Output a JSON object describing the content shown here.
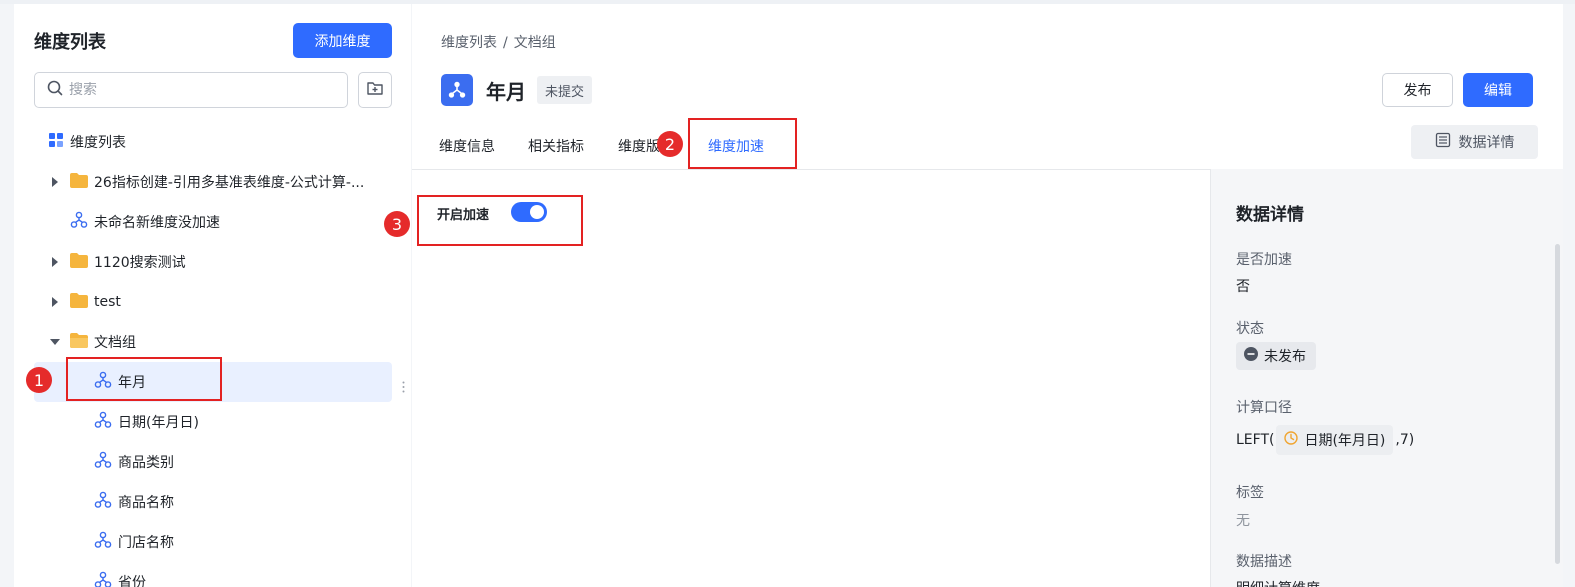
{
  "sidebar": {
    "title": "维度列表",
    "add_button": "添加维度",
    "search_placeholder": "搜索",
    "items": [
      {
        "label": "维度列表",
        "type": "root"
      },
      {
        "label": "26指标创建-引用多基准表维度-公式计算-...",
        "type": "folder",
        "state": "collapsed"
      },
      {
        "label": "未命名新维度没加速",
        "type": "dimension"
      },
      {
        "label": "1120搜索测试",
        "type": "folder",
        "state": "collapsed"
      },
      {
        "label": "test",
        "type": "folder",
        "state": "collapsed"
      },
      {
        "label": "文档组",
        "type": "folder",
        "state": "expanded"
      },
      {
        "label": "年月",
        "type": "dimension",
        "selected": true
      },
      {
        "label": "日期(年月日)",
        "type": "dimension"
      },
      {
        "label": "商品类别",
        "type": "dimension"
      },
      {
        "label": "商品名称",
        "type": "dimension"
      },
      {
        "label": "门店名称",
        "type": "dimension"
      },
      {
        "label": "省份",
        "type": "dimension"
      }
    ]
  },
  "main": {
    "breadcrumb": [
      "维度列表",
      "文档组"
    ],
    "breadcrumb_separator": "/",
    "title": "年月",
    "status_badge": "未提交",
    "publish_button": "发布",
    "edit_button": "编辑",
    "tabs": [
      "维度信息",
      "相关指标",
      "维度版",
      "维度加速"
    ],
    "active_tab": "维度加速",
    "detail_button": "数据详情",
    "toggle_label": "开启加速",
    "toggle_on": true
  },
  "details": {
    "title": "数据详情",
    "accelerated_label": "是否加速",
    "accelerated_value": "否",
    "status_label": "状态",
    "status_value": "未发布",
    "formula_label": "计算口径",
    "formula_prefix": "LEFT(",
    "formula_ref": "日期(年月日)",
    "formula_suffix": ",7)",
    "tags_label": "标签",
    "tags_value": "无",
    "desc_label": "数据描述",
    "desc_value": "明细计算维度"
  },
  "annotations": {
    "marker1": "1",
    "marker2": "2",
    "marker3": "3"
  },
  "colors": {
    "primary": "#2f6bff",
    "highlight": "#e32222",
    "folder": "#f5b53d"
  }
}
